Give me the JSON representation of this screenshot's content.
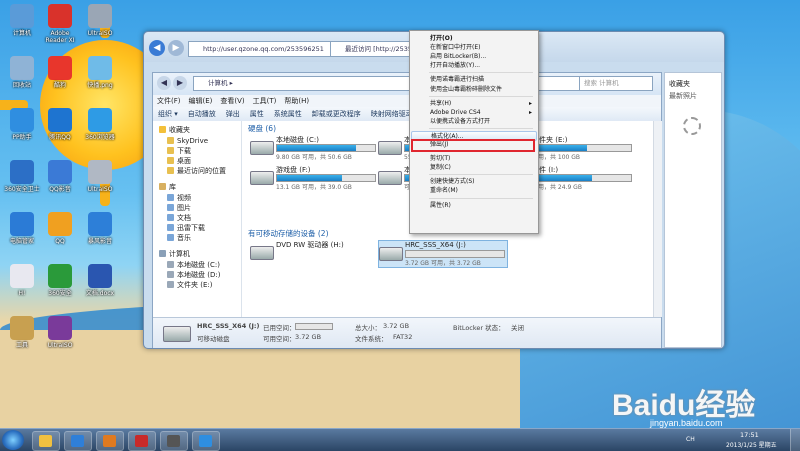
{
  "desktop": {
    "icons": [
      {
        "label": "计算机",
        "icon": "computer-icon"
      },
      {
        "label": "Adobe Reader XI",
        "icon": "pdf-icon"
      },
      {
        "label": "UltraISO",
        "icon": "disc-icon"
      },
      {
        "label": "回收站",
        "icon": "recycle-bin-icon"
      },
      {
        "label": "酷狗",
        "icon": "app-icon"
      },
      {
        "label": "快播.png",
        "icon": "image-icon"
      },
      {
        "label": "PP助手",
        "icon": "app-icon"
      },
      {
        "label": "腾讯QQ",
        "icon": "app-icon"
      },
      {
        "label": "360浏览器",
        "icon": "browser-icon"
      },
      {
        "label": "360安全卫士",
        "icon": "shield-icon"
      },
      {
        "label": "QQ影音",
        "icon": "media-icon"
      },
      {
        "label": "UltraISO",
        "icon": "disc-icon"
      },
      {
        "label": "电脑管家",
        "icon": "shield-icon"
      },
      {
        "label": "QQ",
        "icon": "qq-icon"
      },
      {
        "label": "暴风影音",
        "icon": "media-icon"
      },
      {
        "label": "H!",
        "icon": "app-icon"
      },
      {
        "label": "360安全",
        "icon": "app-icon"
      },
      {
        "label": "文档.docx",
        "icon": "word-icon"
      },
      {
        "label": "工具",
        "icon": "folder-icon"
      },
      {
        "label": "UltraISO",
        "icon": "archive-icon"
      }
    ]
  },
  "browser": {
    "address": "http://user.qzone.qq.com/253596251",
    "tab_title": "最近访问 [http://253596"
  },
  "explorer": {
    "breadcrumb": "计算机 ▸",
    "search_placeholder": "搜索 计算机",
    "menu": [
      "文件(F)",
      "编辑(E)",
      "查看(V)",
      "工具(T)",
      "帮助(H)"
    ],
    "toolbar": [
      "组织 ▾",
      "自动播放",
      "弹出",
      "属性",
      "系统属性",
      "卸载或更改程序",
      "映射网络驱动器"
    ],
    "nav": {
      "favorites_header": "收藏夹",
      "favorites": [
        "SkyDrive",
        "下载",
        "桌面",
        "最近访问的位置"
      ],
      "libraries_header": "库",
      "libraries": [
        "视频",
        "图片",
        "文档",
        "迅雷下载",
        "音乐"
      ],
      "computer_header": "计算机",
      "computer": [
        "本地磁盘 (C:)",
        "本地磁盘 (D:)",
        "文件夹 (E:)"
      ]
    },
    "group_hdd": "硬盘 (6)",
    "drives": [
      {
        "name": "本地磁盘 (C:)",
        "free": "9.80 GB 可用，共 50.6 GB",
        "used_fraction": 0.81
      },
      {
        "name": "本地磁盘",
        "free": "55.4 GB 可用",
        "used_fraction": 0.5
      },
      {
        "name": "文件夹 (E:)",
        "free": "可用，共 100 GB",
        "used_fraction": 0.55
      },
      {
        "name": "游戏盘 (F:)",
        "free": "13.1 GB 可用，共 39.0 GB",
        "used_fraction": 0.66
      },
      {
        "name": "本地磁盘",
        "free": "可用",
        "used_fraction": 0.4
      },
      {
        "name": "软件 (I:)",
        "free": "可用，共 24.9 GB",
        "used_fraction": 0.6
      }
    ],
    "group_removable": "有可移动存储的设备 (2)",
    "removables": [
      {
        "name": "DVD RW 驱动器 (H:)"
      },
      {
        "name": "HRC_SSS_X64 (J:)",
        "free": "3.72 GB 可用，共 3.72 GB",
        "used_fraction": 0.0
      }
    ],
    "status": {
      "name": "HRC_SSS_X64 (J:)",
      "used_label": "已用空间：",
      "free_label": "可用空间：",
      "free": "3.72 GB",
      "type": "可移动磁盘",
      "total_label": "总大小：",
      "total": "3.72 GB",
      "fs_label": "文件系统：",
      "fs": "FAT32",
      "bitlocker_label": "BitLocker 状态：",
      "bitlocker": "关闭"
    }
  },
  "ie_panel": {
    "label": "收藏夹",
    "sub": "最新照片"
  },
  "context_menu": {
    "items": [
      {
        "label": "打开(O)",
        "bold": true
      },
      {
        "label": "在新窗口中打开(E)"
      },
      {
        "label": "启用 BitLocker(B)..."
      },
      {
        "label": "打开自动播放(Y)..."
      },
      {
        "label": "sep"
      },
      {
        "label": "使用诺毒霸进行扫描"
      },
      {
        "label": "使用金山毒霸粉碎删除文件"
      },
      {
        "label": "sep"
      },
      {
        "label": "共享(H)",
        "submenu": true
      },
      {
        "label": "Adobe Drive CS4",
        "submenu": true
      },
      {
        "label": "以便携式设备方式打开"
      },
      {
        "label": "sep"
      },
      {
        "label": "格式化(A)...",
        "highlight": true
      },
      {
        "label": "弹出(J)"
      },
      {
        "label": "sep"
      },
      {
        "label": "剪切(T)"
      },
      {
        "label": "复制(C)"
      },
      {
        "label": "sep"
      },
      {
        "label": "创建快捷方式(S)"
      },
      {
        "label": "重命名(M)"
      },
      {
        "label": "sep"
      },
      {
        "label": "属性(R)"
      }
    ]
  },
  "taskbar": {
    "apps": [
      "folder-icon",
      "ie-icon",
      "media-player-icon",
      "flash-icon",
      "film-icon",
      "k-app-icon"
    ],
    "lang": "CH",
    "time": "17:51",
    "date": "2013/1/25 星期五"
  },
  "watermark": {
    "text": "Baidu经验",
    "url": "jingyan.baidu.com"
  }
}
